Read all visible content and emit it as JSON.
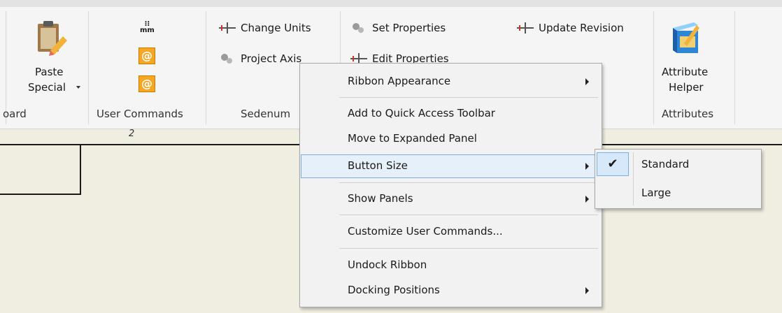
{
  "ribbon": {
    "clipboard": {
      "paste_label": "Paste",
      "special_label": "Special",
      "group_label": "oard"
    },
    "user_commands": {
      "units_label": "mm",
      "group_label": "User Commands"
    },
    "sedenum": {
      "change_units": "Change Units",
      "project_axis": "Project Axis",
      "group_label": "Sedenum"
    },
    "properties": {
      "set_properties": "Set Properties",
      "edit_properties": "Edit Properties",
      "update_revision": "Update Revision"
    },
    "attributes": {
      "helper_line1": "Attribute",
      "helper_line2": "Helper",
      "group_label": "Attributes"
    }
  },
  "canvas": {
    "page_marker": "2"
  },
  "context_menu": {
    "items": [
      {
        "label": "Ribbon Appearance",
        "has_submenu": true
      },
      {
        "label": "Add to Quick Access Toolbar",
        "has_submenu": false
      },
      {
        "label": "Move to Expanded Panel",
        "has_submenu": false
      },
      {
        "label": "Button Size",
        "has_submenu": true,
        "highlighted": true
      },
      {
        "label": "Show Panels",
        "has_submenu": true
      },
      {
        "label": "Customize User Commands...",
        "has_submenu": false
      },
      {
        "label": "Undock Ribbon",
        "has_submenu": false
      },
      {
        "label": "Docking Positions",
        "has_submenu": true
      }
    ]
  },
  "button_size_submenu": {
    "options": [
      {
        "label": "Standard",
        "checked": true
      },
      {
        "label": "Large",
        "checked": false
      }
    ]
  },
  "colors": {
    "accent": "#7aafe6",
    "highlight": "#e6f0fb",
    "canvas": "#f0eee1",
    "ribbon": "#f5f5f5"
  }
}
